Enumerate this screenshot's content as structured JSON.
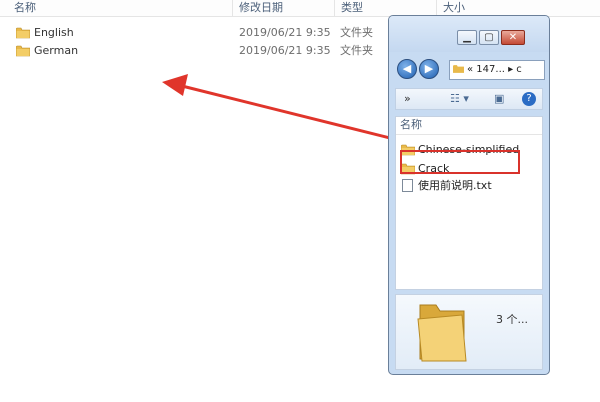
{
  "main_list": {
    "columns": {
      "name": "名称",
      "modified": "修改日期",
      "type": "类型",
      "size": "大小"
    },
    "rows": [
      {
        "name": "English",
        "modified": "2019/06/21 9:35",
        "type": "文件夹"
      },
      {
        "name": "German",
        "modified": "2019/06/21 9:35",
        "type": "文件夹"
      }
    ]
  },
  "window": {
    "address": "« 147... ▸ c",
    "toolbar": {
      "more": "»"
    },
    "list_header": "名称",
    "items": [
      {
        "name": "Chinese-simplified",
        "kind": "folder"
      },
      {
        "name": "Crack",
        "kind": "folder"
      },
      {
        "name": "使用前说明.txt",
        "kind": "txt"
      }
    ],
    "details_count": "3 个..."
  },
  "colors": {
    "folder": "#e8b94a",
    "arrow": "#e0352b",
    "highlight_box": "#d9322b"
  }
}
